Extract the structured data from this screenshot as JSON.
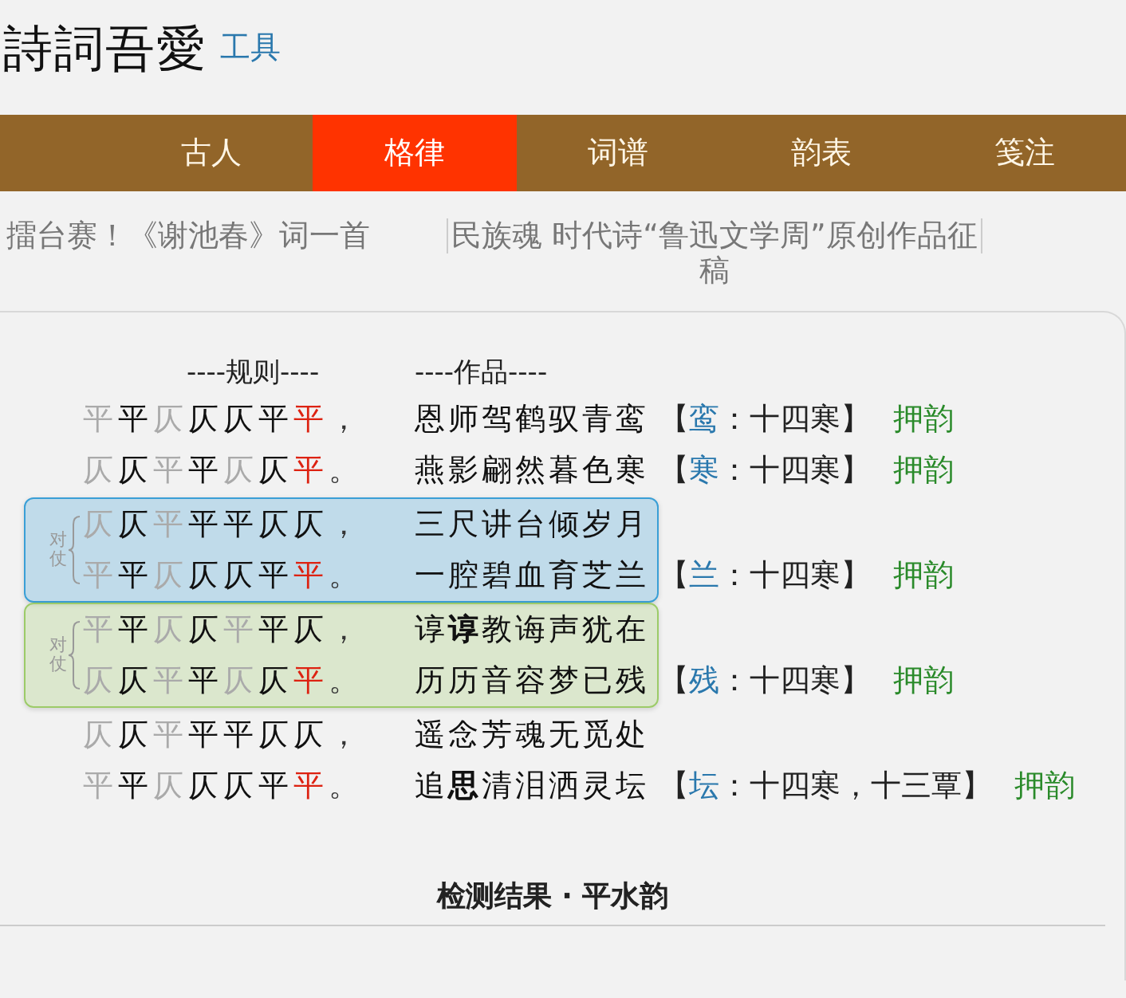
{
  "header": {
    "logo": "詩詞吾愛",
    "tool_link": "工具"
  },
  "nav": {
    "tabs": [
      {
        "label": "古人",
        "selected": false
      },
      {
        "label": "格律",
        "selected": true
      },
      {
        "label": "词谱",
        "selected": false
      },
      {
        "label": "韵表",
        "selected": false
      },
      {
        "label": "笺注",
        "selected": false
      }
    ]
  },
  "ticker": [
    {
      "text": "擂台赛！《谢池春》词一首"
    },
    {
      "text": "民族魂 时代诗“鲁迅文学周”原创作品征稿"
    }
  ],
  "check": {
    "rule_heading": "----规则----",
    "work_heading": "----作品----",
    "groups": [
      {
        "kind": "single",
        "lines": [
          {
            "rule": [
              {
                "c": "平",
                "kind": "free"
              },
              {
                "c": "平",
                "kind": "fixed"
              },
              {
                "c": "仄",
                "kind": "free"
              },
              {
                "c": "仄",
                "kind": "fixed"
              },
              {
                "c": "仄",
                "kind": "fixed"
              },
              {
                "c": "平",
                "kind": "fixed"
              },
              {
                "c": "平",
                "kind": "rhyme"
              },
              {
                "c": "，",
                "kind": "punct"
              }
            ],
            "work": "恩师驾鹤驭青鸾",
            "rhyme": {
              "open": "【",
              "char": "鸾",
              "rest": "：十四寒】",
              "verdict": "押韵"
            }
          },
          {
            "rule": [
              {
                "c": "仄",
                "kind": "free"
              },
              {
                "c": "仄",
                "kind": "fixed"
              },
              {
                "c": "平",
                "kind": "free"
              },
              {
                "c": "平",
                "kind": "fixed"
              },
              {
                "c": "仄",
                "kind": "free"
              },
              {
                "c": "仄",
                "kind": "fixed"
              },
              {
                "c": "平",
                "kind": "rhyme"
              },
              {
                "c": "。",
                "kind": "punct"
              }
            ],
            "work": "燕影翩然暮色寒",
            "rhyme": {
              "open": "【",
              "char": "寒",
              "rest": "：十四寒】",
              "verdict": "押韵"
            }
          }
        ]
      },
      {
        "kind": "pair",
        "label": "对仗",
        "color": "#3a9fd6",
        "lines": [
          {
            "rule": [
              {
                "c": "仄",
                "kind": "free"
              },
              {
                "c": "仄",
                "kind": "fixed"
              },
              {
                "c": "平",
                "kind": "free"
              },
              {
                "c": "平",
                "kind": "fixed"
              },
              {
                "c": "平",
                "kind": "fixed"
              },
              {
                "c": "仄",
                "kind": "fixed"
              },
              {
                "c": "仄",
                "kind": "fixed"
              },
              {
                "c": "，",
                "kind": "punct"
              }
            ],
            "work": "三尺讲台倾岁月"
          },
          {
            "rule": [
              {
                "c": "平",
                "kind": "free"
              },
              {
                "c": "平",
                "kind": "fixed"
              },
              {
                "c": "仄",
                "kind": "free"
              },
              {
                "c": "仄",
                "kind": "fixed"
              },
              {
                "c": "仄",
                "kind": "fixed"
              },
              {
                "c": "平",
                "kind": "fixed"
              },
              {
                "c": "平",
                "kind": "rhyme"
              },
              {
                "c": "。",
                "kind": "punct"
              }
            ],
            "work": "一腔碧血育芝兰",
            "rhyme": {
              "open": "【",
              "char": "兰",
              "rest": "：十四寒】",
              "verdict": "押韵"
            }
          }
        ]
      },
      {
        "kind": "pair",
        "label": "对仗",
        "color": "#9ccb68",
        "lines": [
          {
            "rule": [
              {
                "c": "平",
                "kind": "free"
              },
              {
                "c": "平",
                "kind": "fixed"
              },
              {
                "c": "仄",
                "kind": "free"
              },
              {
                "c": "仄",
                "kind": "fixed"
              },
              {
                "c": "平",
                "kind": "free"
              },
              {
                "c": "平",
                "kind": "fixed"
              },
              {
                "c": "仄",
                "kind": "fixed"
              },
              {
                "c": "，",
                "kind": "punct"
              }
            ],
            "work": "谆**谆**教诲声犹在"
          },
          {
            "rule": [
              {
                "c": "仄",
                "kind": "free"
              },
              {
                "c": "仄",
                "kind": "fixed"
              },
              {
                "c": "平",
                "kind": "free"
              },
              {
                "c": "平",
                "kind": "fixed"
              },
              {
                "c": "仄",
                "kind": "free"
              },
              {
                "c": "仄",
                "kind": "fixed"
              },
              {
                "c": "平",
                "kind": "rhyme"
              },
              {
                "c": "。",
                "kind": "punct"
              }
            ],
            "work": "历历音容梦已残",
            "rhyme": {
              "open": "【",
              "char": "残",
              "rest": "：十四寒】",
              "verdict": "押韵"
            }
          }
        ]
      },
      {
        "kind": "single",
        "lines": [
          {
            "rule": [
              {
                "c": "仄",
                "kind": "free"
              },
              {
                "c": "仄",
                "kind": "fixed"
              },
              {
                "c": "平",
                "kind": "free"
              },
              {
                "c": "平",
                "kind": "fixed"
              },
              {
                "c": "平",
                "kind": "fixed"
              },
              {
                "c": "仄",
                "kind": "fixed"
              },
              {
                "c": "仄",
                "kind": "fixed"
              },
              {
                "c": "，",
                "kind": "punct"
              }
            ],
            "work": "遥念芳魂无觅处"
          },
          {
            "rule": [
              {
                "c": "平",
                "kind": "free"
              },
              {
                "c": "平",
                "kind": "fixed"
              },
              {
                "c": "仄",
                "kind": "free"
              },
              {
                "c": "仄",
                "kind": "fixed"
              },
              {
                "c": "仄",
                "kind": "fixed"
              },
              {
                "c": "平",
                "kind": "fixed"
              },
              {
                "c": "平",
                "kind": "rhyme"
              },
              {
                "c": "。",
                "kind": "punct"
              }
            ],
            "work": "追**思**清泪洒灵坛",
            "rhyme": {
              "open": "【",
              "char": "坛",
              "rest": "：十四寒，十三覃】",
              "verdict": "押韵"
            }
          }
        ]
      }
    ]
  },
  "result_heading": "检测结果 · 平水韵"
}
